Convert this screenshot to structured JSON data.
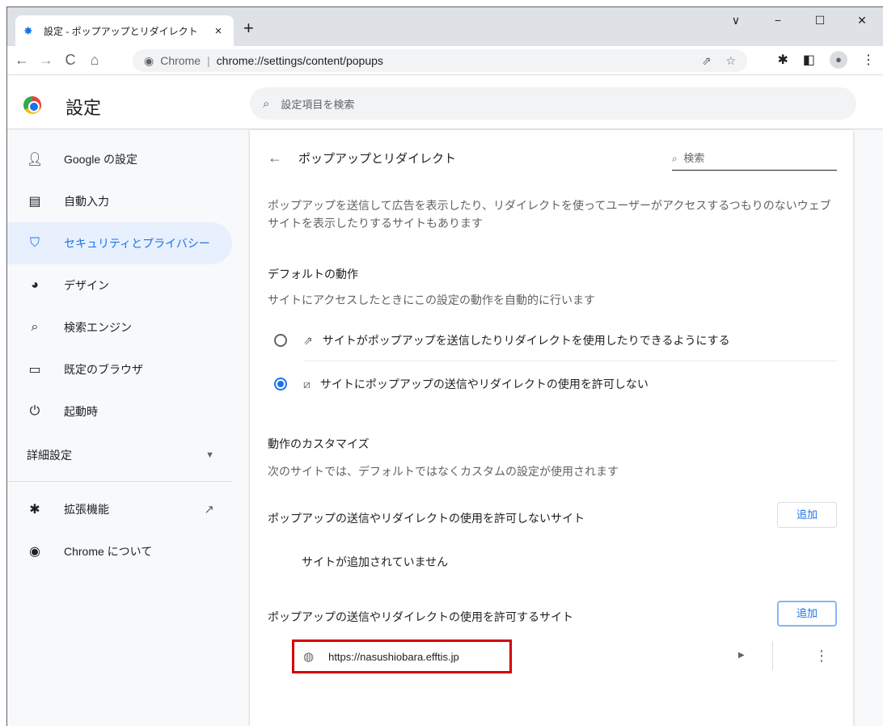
{
  "tab": {
    "title": "設定 - ポップアップとリダイレクト",
    "close": "×",
    "new_tab": "+"
  },
  "window": {
    "minimize": "−",
    "maximize": "☐",
    "close": "✕",
    "dropdown": "∨"
  },
  "omnibox": {
    "site_label": "Chrome",
    "separator": "|",
    "url": "chrome://settings/content/popups"
  },
  "settings_header": {
    "title": "設定",
    "search_placeholder": "設定項目を検索"
  },
  "sidebar": {
    "items": [
      {
        "label": "Google の設定",
        "icon": "person-icon"
      },
      {
        "label": "自動入力",
        "icon": "clipboard-icon"
      },
      {
        "label": "セキュリティとプライバシー",
        "icon": "shield-icon",
        "active": true
      },
      {
        "label": "デザイン",
        "icon": "palette-icon"
      },
      {
        "label": "検索エンジン",
        "icon": "search-icon"
      },
      {
        "label": "既定のブラウザ",
        "icon": "browser-icon"
      },
      {
        "label": "起動時",
        "icon": "power-icon"
      }
    ],
    "advanced": "詳細設定",
    "extensions": "拡張機能",
    "about": "Chrome について"
  },
  "page": {
    "title": "ポップアップとリダイレクト",
    "search_label": "検索",
    "description": "ポップアップを送信して広告を表示したり、リダイレクトを使ってユーザーがアクセスするつもりのないウェブサイトを表示したりするサイトもあります",
    "default_heading": "デフォルトの動作",
    "default_sub": "サイトにアクセスしたときにこの設定の動作を自動的に行います",
    "option_allow": "サイトがポップアップを送信したりリダイレクトを使用したりできるようにする",
    "option_block": "サイトにポップアップの送信やリダイレクトの使用を許可しない",
    "custom_heading": "動作のカスタマイズ",
    "custom_sub": "次のサイトでは、デフォルトではなくカスタムの設定が使用されます",
    "block_list_title": "ポップアップの送信やリダイレクトの使用を許可しないサイト",
    "add_label": "追加",
    "no_sites": "サイトが追加されていません",
    "allow_list_title": "ポップアップの送信やリダイレクトの使用を許可するサイト",
    "allowed_site": "https://nasushiobara.efftis.jp"
  },
  "colors": {
    "accent": "#1a73e8",
    "highlight": "#d50000",
    "active_bg": "#e8f0fe"
  }
}
